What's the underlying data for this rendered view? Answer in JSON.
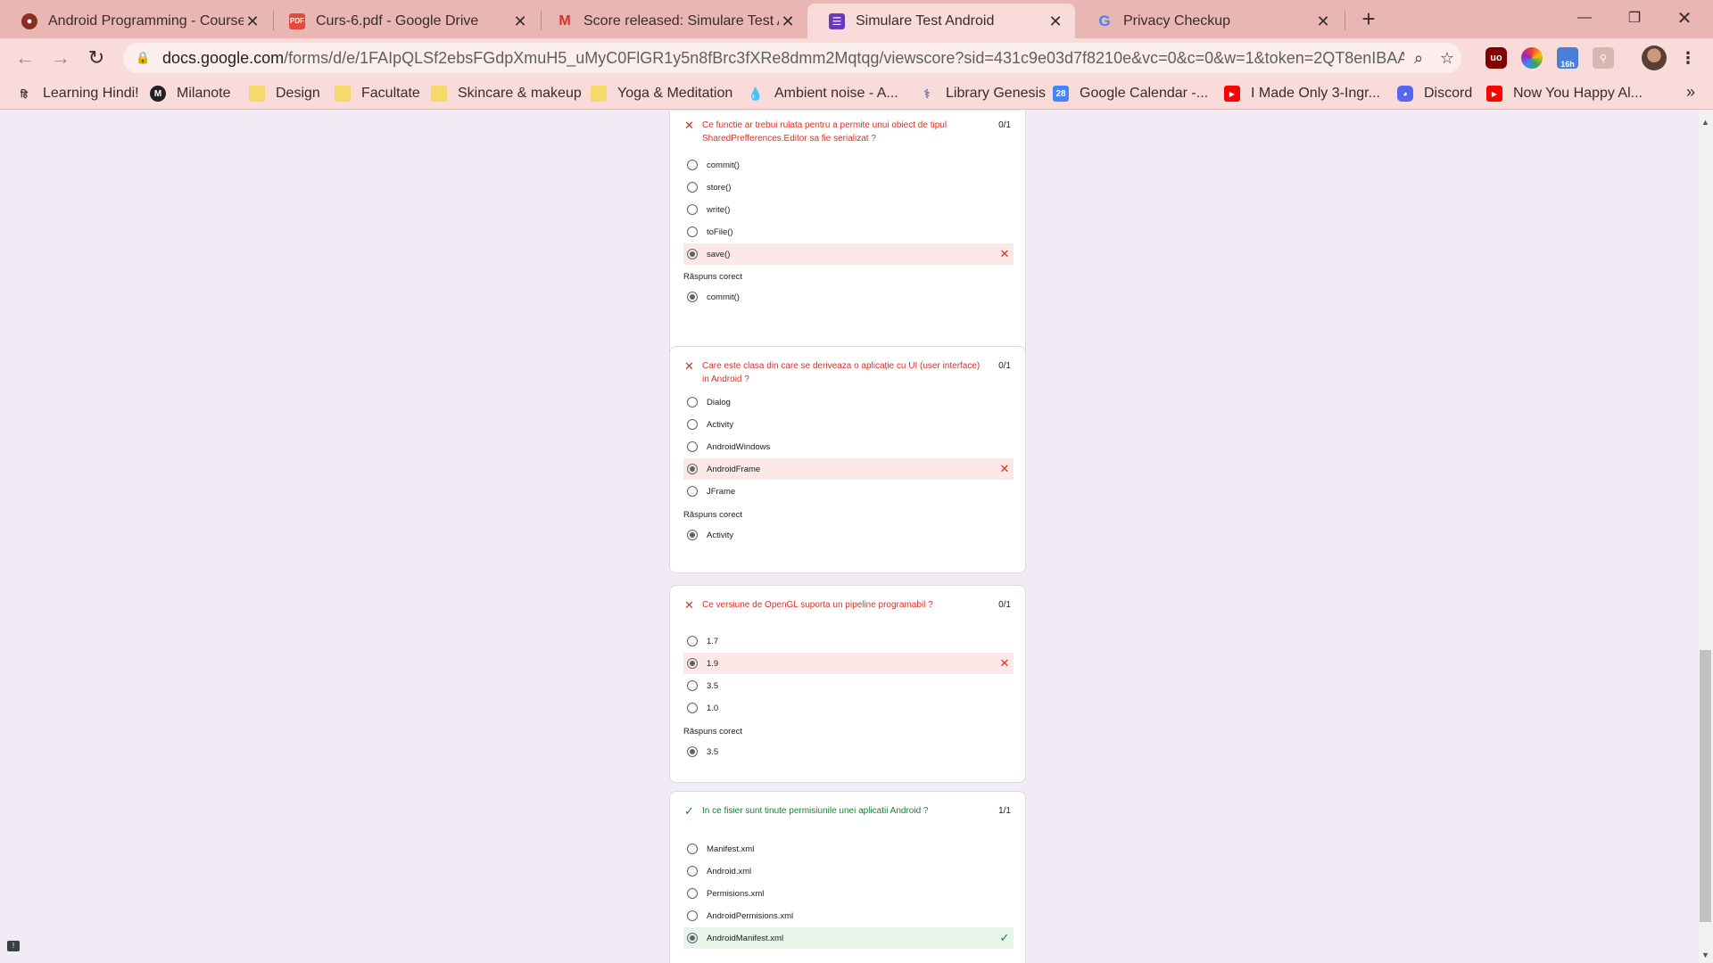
{
  "browser": {
    "tabs": [
      {
        "title": "Android Programming - Courses",
        "icon": "courses-icon",
        "color": "#c0392b"
      },
      {
        "title": "Curs-6.pdf - Google Drive",
        "icon": "pdf-icon",
        "color": "#e04b3b"
      },
      {
        "title": "Score released: Simulare Test Anc",
        "icon": "gmail-icon",
        "color": "#d93025"
      },
      {
        "title": "Simulare Test Android",
        "icon": "forms-icon",
        "color": "#673ab7"
      },
      {
        "title": "Privacy Checkup",
        "icon": "google-icon",
        "color": "#4285f4"
      }
    ],
    "active_tab": 3,
    "url_host": "docs.google.com",
    "url_path": "/forms/d/e/1FAIpQLSf2ebsFGdpXmuH5_uMyC0FlGR1y5n8fBrc3fXRe8dmm2Mqtqg/viewscore?sid=431c9e03d7f8210e&vc=0&c=0&w=1&token=2QT8enIBAAA...",
    "extension_badge": "16h",
    "bookmarks": [
      {
        "label": "Learning Hindi!",
        "icon": "hindi-icon",
        "type": "site"
      },
      {
        "label": "Milanote",
        "icon": "milanote-icon",
        "type": "site"
      },
      {
        "label": "Design",
        "icon": "folder-icon",
        "type": "folder"
      },
      {
        "label": "Facultate",
        "icon": "folder-icon",
        "type": "folder"
      },
      {
        "label": "Skincare & makeup",
        "icon": "folder-icon",
        "type": "folder"
      },
      {
        "label": "Yoga & Meditation",
        "icon": "folder-icon",
        "type": "folder"
      },
      {
        "label": "Ambient noise - A...",
        "icon": "droplet-icon",
        "type": "site"
      },
      {
        "label": "Library Genesis",
        "icon": "library-icon",
        "type": "site"
      },
      {
        "label": "Google Calendar -...",
        "icon": "calendar-icon",
        "type": "site",
        "badge": "28"
      },
      {
        "label": "I Made Only 3-Ingr...",
        "icon": "youtube-icon",
        "type": "site"
      },
      {
        "label": "Discord",
        "icon": "discord-icon",
        "type": "site"
      },
      {
        "label": "Now You Happy Al...",
        "icon": "youtube-icon",
        "type": "site"
      }
    ]
  },
  "form": {
    "correct_answer_label": "Răspuns corect",
    "questions": [
      {
        "status": "wrong",
        "text": "Ce functie ar trebui rulata pentru a permite unui obiect de tipul SharedPrefferences.Editor sa fie serializat ?",
        "score": "0/1",
        "options": [
          "commit()",
          "store()",
          "write()",
          "toFile()",
          "save()"
        ],
        "selected": 4,
        "correct": "commit()"
      },
      {
        "status": "wrong",
        "text": "Care este clasa din care se deriveaza o aplicație cu UI (user interface) in Android ?",
        "score": "0/1",
        "options": [
          "Dialog",
          "Activity",
          "AndroidWindows",
          "AndroidFrame",
          "JFrame"
        ],
        "selected": 3,
        "correct": "Activity"
      },
      {
        "status": "wrong",
        "text": "Ce versiune de OpenGL suporta un pipeline programabil ?",
        "score": "0/1",
        "options": [
          "1.7",
          "1.9",
          "3.5",
          "1.0"
        ],
        "selected": 1,
        "correct": "3.5"
      },
      {
        "status": "right",
        "text": "In ce fisier sunt tinute permisiunile unei aplicatii Android ?",
        "score": "1/1",
        "options": [
          "Manifest.xml",
          "Android.xml",
          "Permisions.xml",
          "AndroidPermisions.xml",
          "AndroidManifest.xml"
        ],
        "selected": 4,
        "correct": null
      }
    ]
  }
}
